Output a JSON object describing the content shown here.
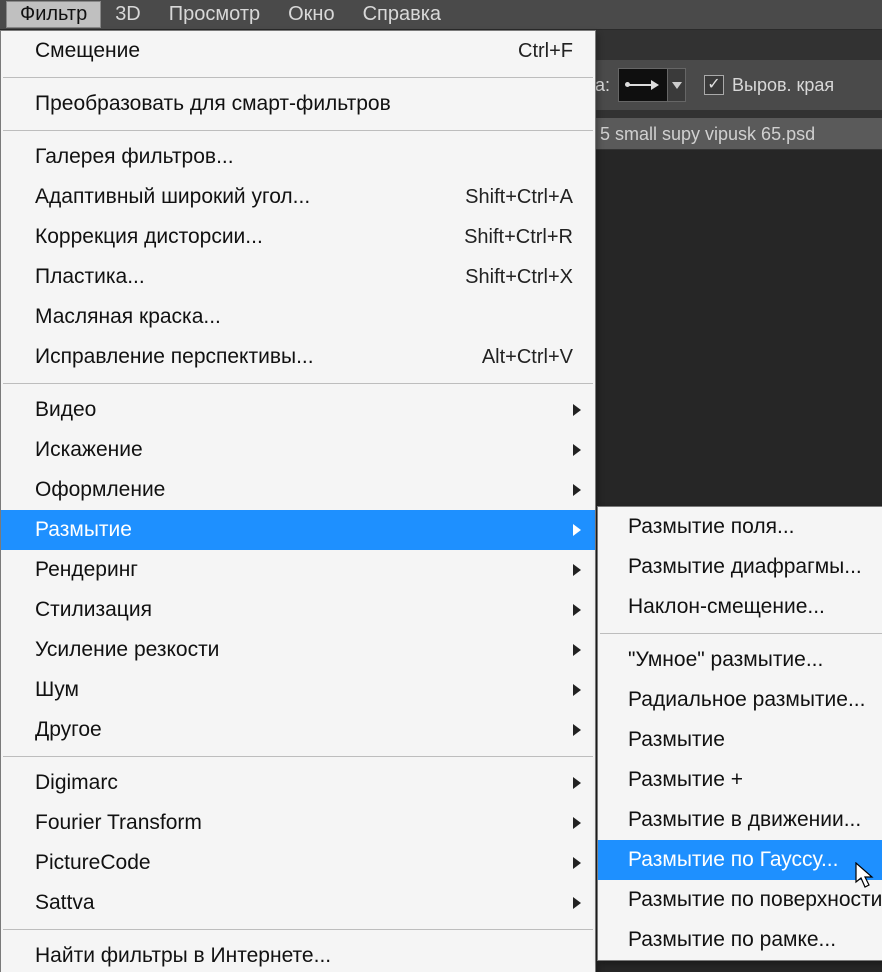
{
  "menubar": {
    "items": [
      "Фильтр",
      "3D",
      "Просмотр",
      "Окно",
      "Справка"
    ],
    "active_index": 0
  },
  "optionsbar": {
    "label_fragment": "ра:",
    "checkbox_checked": true,
    "checkbox_label": "Выров. края"
  },
  "doc_tab": {
    "title_fragment": "5 small supy vipusk 65.psd"
  },
  "dropdown": {
    "groups": [
      [
        {
          "label": "Смещение",
          "shortcut": "Ctrl+F"
        }
      ],
      [
        {
          "label": "Преобразовать для смарт-фильтров"
        }
      ],
      [
        {
          "label": "Галерея фильтров..."
        },
        {
          "label": "Адаптивный широкий угол...",
          "shortcut": "Shift+Ctrl+A"
        },
        {
          "label": "Коррекция дисторсии...",
          "shortcut": "Shift+Ctrl+R"
        },
        {
          "label": "Пластика...",
          "shortcut": "Shift+Ctrl+X"
        },
        {
          "label": "Масляная краска..."
        },
        {
          "label": "Исправление перспективы...",
          "shortcut": "Alt+Ctrl+V"
        }
      ],
      [
        {
          "label": "Видео",
          "submenu": true
        },
        {
          "label": "Искажение",
          "submenu": true
        },
        {
          "label": "Оформление",
          "submenu": true
        },
        {
          "label": "Размытие",
          "submenu": true,
          "highlight": true
        },
        {
          "label": "Рендеринг",
          "submenu": true
        },
        {
          "label": "Стилизация",
          "submenu": true
        },
        {
          "label": "Усиление резкости",
          "submenu": true
        },
        {
          "label": "Шум",
          "submenu": true
        },
        {
          "label": "Другое",
          "submenu": true
        }
      ],
      [
        {
          "label": "Digimarc",
          "submenu": true
        },
        {
          "label": "Fourier Transform",
          "submenu": true
        },
        {
          "label": "PictureCode",
          "submenu": true
        },
        {
          "label": "Sattva",
          "submenu": true
        }
      ],
      [
        {
          "label": "Найти фильтры в Интернете..."
        }
      ]
    ]
  },
  "submenu": {
    "groups": [
      [
        {
          "label": "Размытие поля..."
        },
        {
          "label": "Размытие диафрагмы..."
        },
        {
          "label": "Наклон-смещение..."
        }
      ],
      [
        {
          "label": "\"Умное\" размытие..."
        },
        {
          "label": "Радиальное размытие..."
        },
        {
          "label": "Размытие"
        },
        {
          "label": "Размытие +"
        },
        {
          "label": "Размытие в движении..."
        },
        {
          "label": "Размытие по Гауссу...",
          "highlight": true
        },
        {
          "label": "Размытие по поверхности..."
        },
        {
          "label": "Размытие по рамке..."
        }
      ]
    ]
  }
}
